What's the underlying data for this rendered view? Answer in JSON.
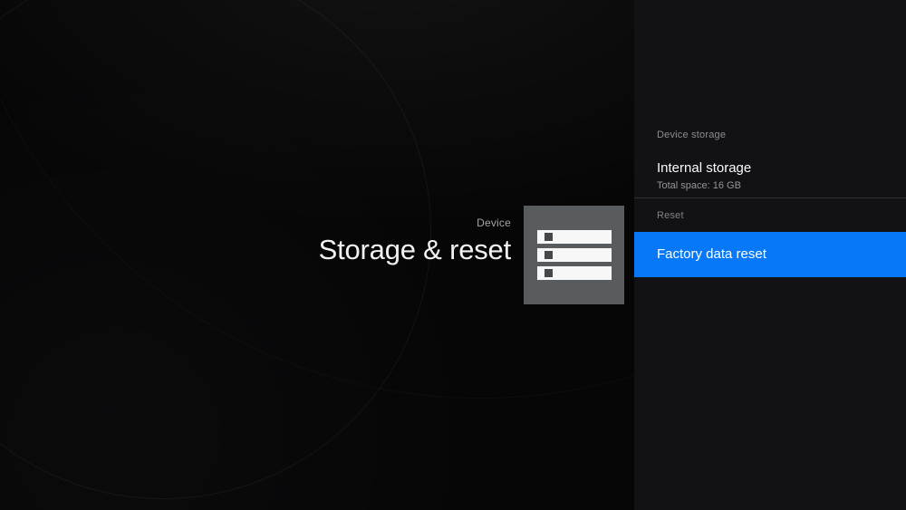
{
  "hero": {
    "category_label": "Device",
    "title": "Storage & reset",
    "icon": "storage-icon"
  },
  "panel": {
    "sections": [
      {
        "header": "Device storage",
        "items": [
          {
            "title": "Internal storage",
            "subtitle": "Total space: 16 GB",
            "selected": false
          }
        ]
      },
      {
        "header": "Reset",
        "items": [
          {
            "title": "Factory data reset",
            "selected": true
          }
        ]
      }
    ],
    "colors": {
      "highlight": "#0778f8",
      "panel_background": "#121214",
      "icon_tile": "#585c5f"
    }
  }
}
